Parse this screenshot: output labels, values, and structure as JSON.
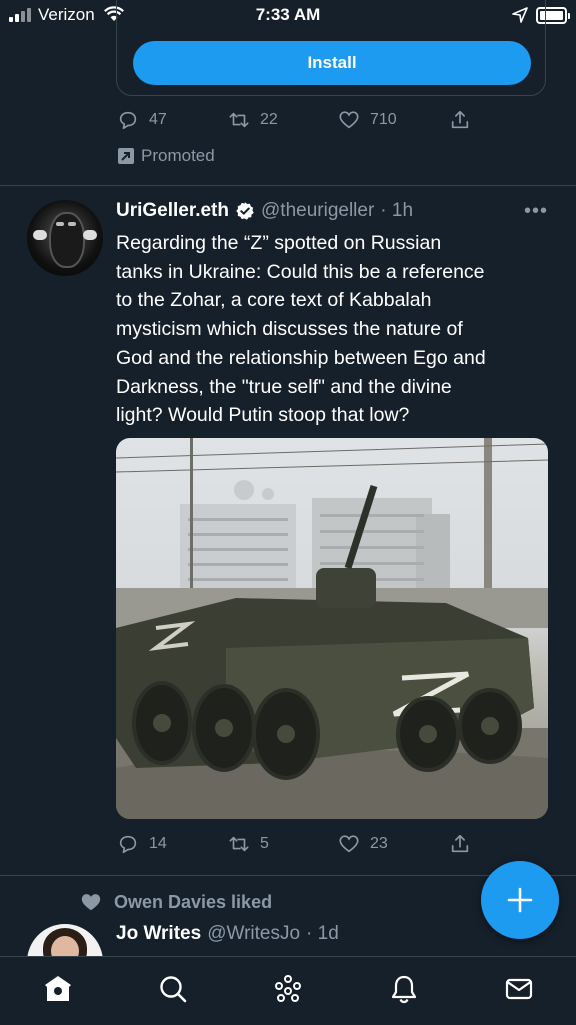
{
  "status_bar": {
    "carrier": "Verizon",
    "time": "7:33 AM"
  },
  "promo": {
    "install_label": "Install",
    "replies": "47",
    "retweets": "22",
    "likes": "710",
    "promoted_label": "Promoted"
  },
  "tweet": {
    "display_name": "UriGeller.eth",
    "handle": "@theurigeller",
    "time": "· 1h",
    "text": "Regarding the “Z” spotted on Russian\ntanks in Ukraine: Could this be a reference\nto the Zohar, a core text of Kabbalah\nmysticism which discusses the nature of\nGod and the relationship between Ego and\nDarkness, the \"true self\" and the divine\nlight? Would Putin stoop that low?",
    "replies": "14",
    "retweets": "5",
    "likes": "23"
  },
  "next_tweet": {
    "liked_by": "Owen Davies liked",
    "display_name": "Jo Writes",
    "handle": "@WritesJo",
    "time": "· 1d"
  },
  "colors": {
    "background": "#15202b",
    "accent": "#1d9bf0",
    "muted": "#8b98a5",
    "border": "#38444d"
  },
  "tabs": [
    "home-icon",
    "search-icon",
    "spaces-icon",
    "notifications-icon",
    "messages-icon"
  ]
}
